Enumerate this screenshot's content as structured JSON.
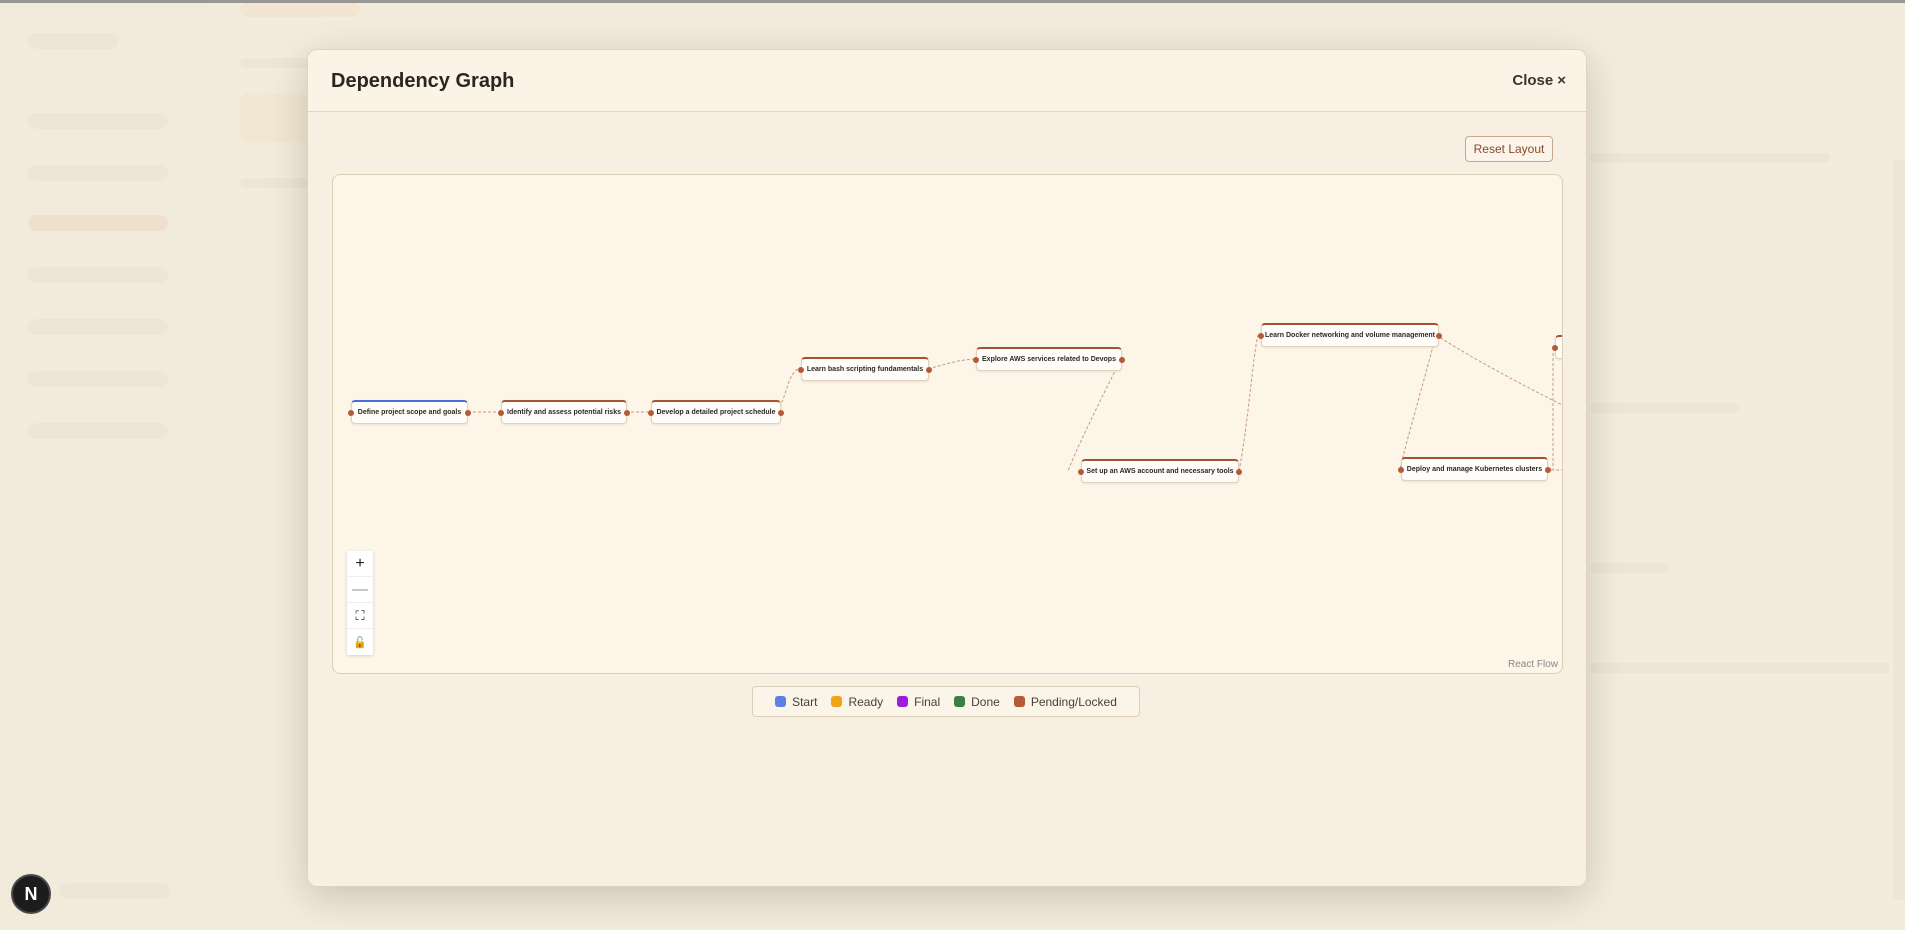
{
  "modal": {
    "title": "Dependency Graph",
    "close_label": "Close",
    "close_icon": "×",
    "reset_label": "Reset Layout"
  },
  "graph": {
    "nodes": [
      {
        "label": "Define project scope and goals",
        "status": "start"
      },
      {
        "label": "Identify and assess potential risks",
        "status": "pending"
      },
      {
        "label": "Develop a detailed project schedule",
        "status": "pending"
      },
      {
        "label": "Learn bash scripting fundamentals",
        "status": "pending"
      },
      {
        "label": "Explore AWS services related to Devops",
        "status": "pending"
      },
      {
        "label": "Set up an AWS account and necessary tools",
        "status": "pending"
      },
      {
        "label": "Learn Docker networking and volume management",
        "status": "pending"
      },
      {
        "label": "Deploy and manage Kubernetes clusters",
        "status": "pending"
      }
    ],
    "controls": {
      "zoom_in": "+",
      "zoom_out": "—",
      "fit_view": "⛶",
      "lock": "🔓"
    },
    "attribution": "React Flow"
  },
  "legend": [
    {
      "label": "Start",
      "color": "#5b7fe8"
    },
    {
      "label": "Ready",
      "color": "#f0a418"
    },
    {
      "label": "Final",
      "color": "#9b1ee0"
    },
    {
      "label": "Done",
      "color": "#3e7d45"
    },
    {
      "label": "Pending/Locked",
      "color": "#b35a36"
    }
  ],
  "badge": {
    "letter": "N"
  }
}
